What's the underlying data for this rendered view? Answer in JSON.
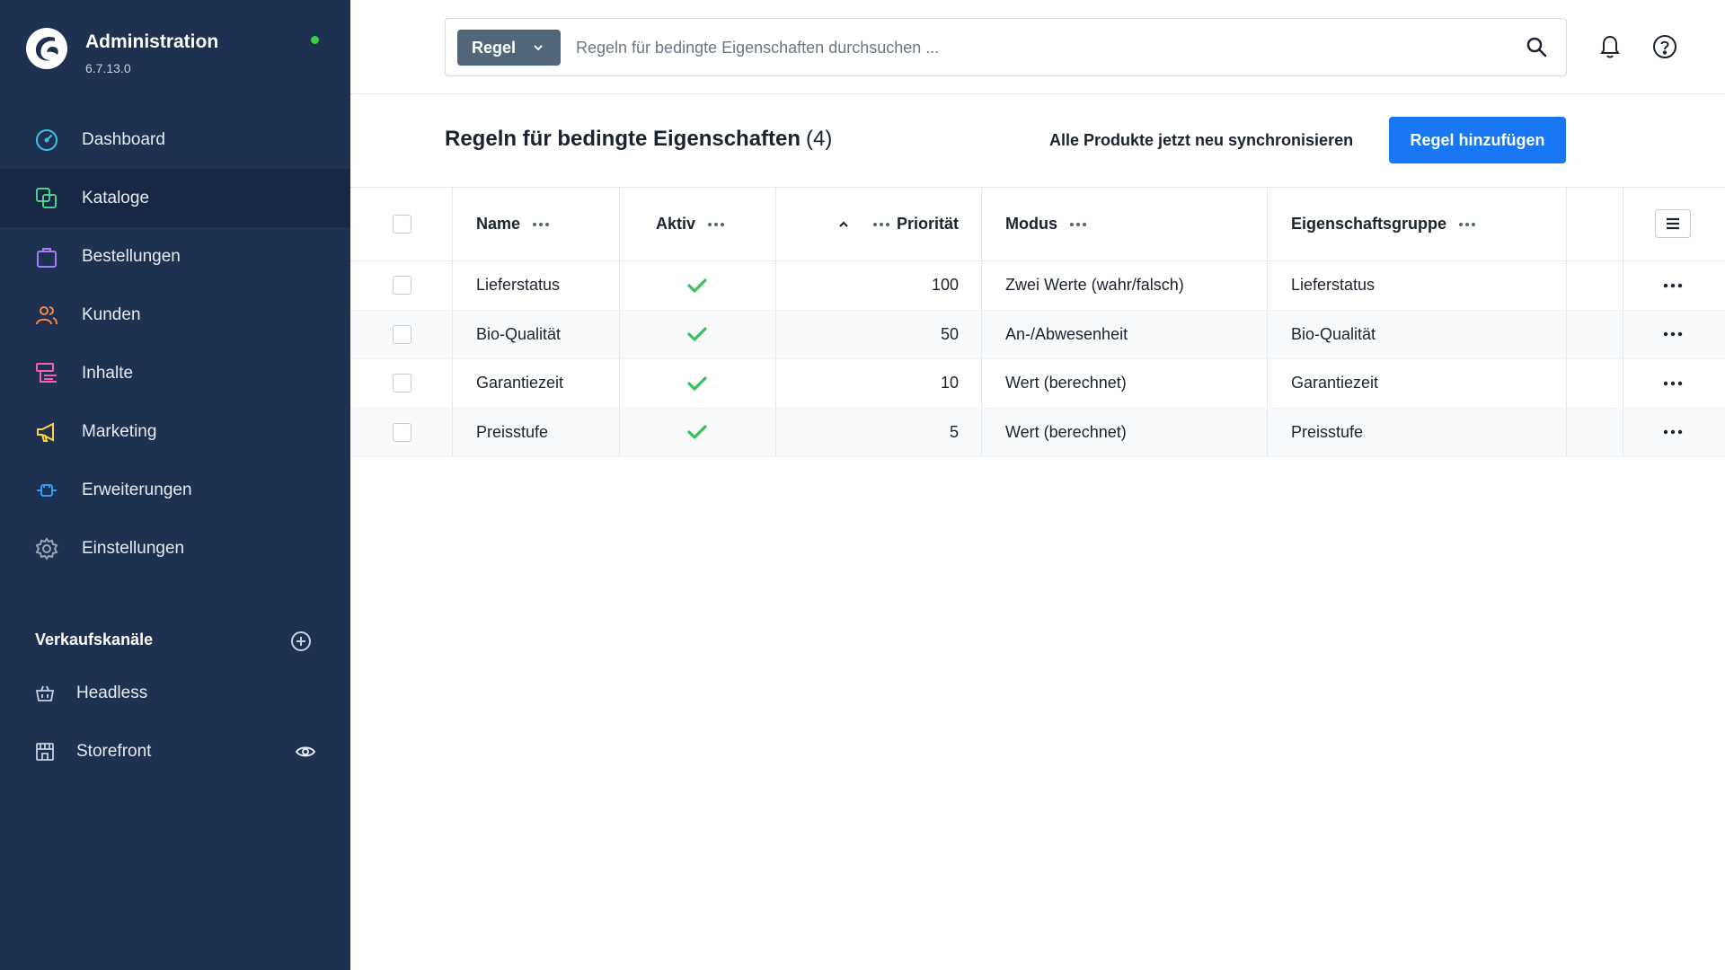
{
  "app": {
    "title": "Administration",
    "version": "6.7.13.0",
    "status_color": "#37d046"
  },
  "sidebar": {
    "items": [
      {
        "label": "Dashboard",
        "icon": "dashboard-icon",
        "color": "#3ec4e8",
        "active": false
      },
      {
        "label": "Kataloge",
        "icon": "catalog-icon",
        "color": "#47d18b",
        "active": true
      },
      {
        "label": "Bestellungen",
        "icon": "shopping-bag-icon",
        "color": "#a57df5",
        "active": false
      },
      {
        "label": "Kunden",
        "icon": "customers-icon",
        "color": "#f5894b",
        "active": false
      },
      {
        "label": "Inhalte",
        "icon": "content-icon",
        "color": "#f062b5",
        "active": false
      },
      {
        "label": "Marketing",
        "icon": "megaphone-icon",
        "color": "#ffd23f",
        "active": false
      },
      {
        "label": "Erweiterungen",
        "icon": "plugin-icon",
        "color": "#2c9cf5",
        "active": false
      },
      {
        "label": "Einstellungen",
        "icon": "gear-icon",
        "color": "#9aa6b6",
        "active": false
      }
    ],
    "channels_title": "Verkaufskanäle",
    "channels": [
      {
        "label": "Headless",
        "icon": "basket-icon"
      },
      {
        "label": "Storefront",
        "icon": "storefront-icon"
      }
    ]
  },
  "search": {
    "type_label": "Regel",
    "placeholder": "Regeln für bedingte Eigenschaften durchsuchen ..."
  },
  "header": {
    "title": "Regeln für bedingte Eigenschaften",
    "count": "(4)",
    "sync_label": "Alle Produkte jetzt neu synchronisieren",
    "add_label": "Regel hinzufügen",
    "accent": "#1877f2"
  },
  "table": {
    "columns": {
      "name": "Name",
      "active": "Aktiv",
      "priority": "Priorität",
      "mode": "Modus",
      "group": "Eigenschaftsgruppe"
    },
    "rows": [
      {
        "name": "Lieferstatus",
        "active": true,
        "priority": "100",
        "mode": "Zwei Werte (wahr/falsch)",
        "group": "Lieferstatus"
      },
      {
        "name": "Bio-Qualität",
        "active": true,
        "priority": "50",
        "mode": "An-/Abwesenheit",
        "group": "Bio-Qualität"
      },
      {
        "name": "Garantiezeit",
        "active": true,
        "priority": "10",
        "mode": "Wert (berechnet)",
        "group": "Garantiezeit"
      },
      {
        "name": "Preisstufe",
        "active": true,
        "priority": "5",
        "mode": "Wert (berechnet)",
        "group": "Preisstufe"
      }
    ],
    "check_color": "#37c15a"
  }
}
